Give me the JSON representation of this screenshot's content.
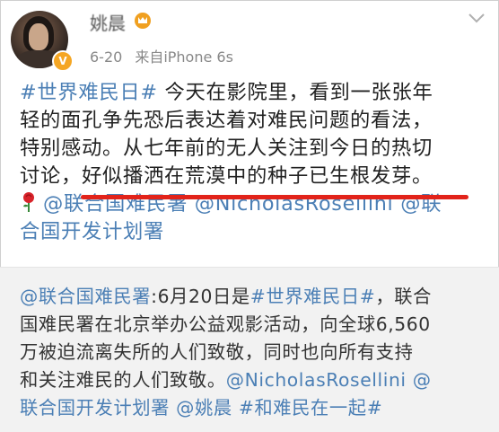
{
  "user": {
    "name": "姚晨",
    "verified_badge": "V",
    "date": "6-20",
    "source": "来自iPhone 6s"
  },
  "post": {
    "lines": [
      [
        "#世界难民日#",
        " 今天在影院里，看到一张张年"
      ],
      [
        "轻的面孔争先恐后表达着对难民问题的看法，"
      ],
      [
        "特别感动。从七年前的无人关注到今日的热切"
      ],
      [
        "讨论，",
        "好似播洒在荒漠中的种子已生根发芽。"
      ],
      [
        "@联合国难民署",
        " ",
        "@NicholasRosellini",
        " ",
        "@联"
      ],
      [
        "合国开发计划署"
      ]
    ]
  },
  "repost": {
    "lines": [
      [
        "@联合国难民署",
        ":6月20日是",
        "#世界难民日#",
        "，联合"
      ],
      [
        "国难民署在北京举办公益观影活动，向全球6,560"
      ],
      [
        "万被迫流离失所的人们致敬，同时也向所有支持"
      ],
      [
        "和关注难民的人们致敬。",
        "@NicholasRosellini",
        " ",
        "@"
      ],
      [
        "联合国开发计划署",
        " ",
        "@姚晨",
        " ",
        "#和难民在一起#"
      ]
    ]
  },
  "colors": {
    "link": "#4b7fb5",
    "underline": "#e2231a",
    "repost_bg": "#f2f2f2"
  },
  "icons": [
    "chevron-down-icon",
    "crown-icon",
    "rose-emoji-icon",
    "verified-badge-icon"
  ]
}
